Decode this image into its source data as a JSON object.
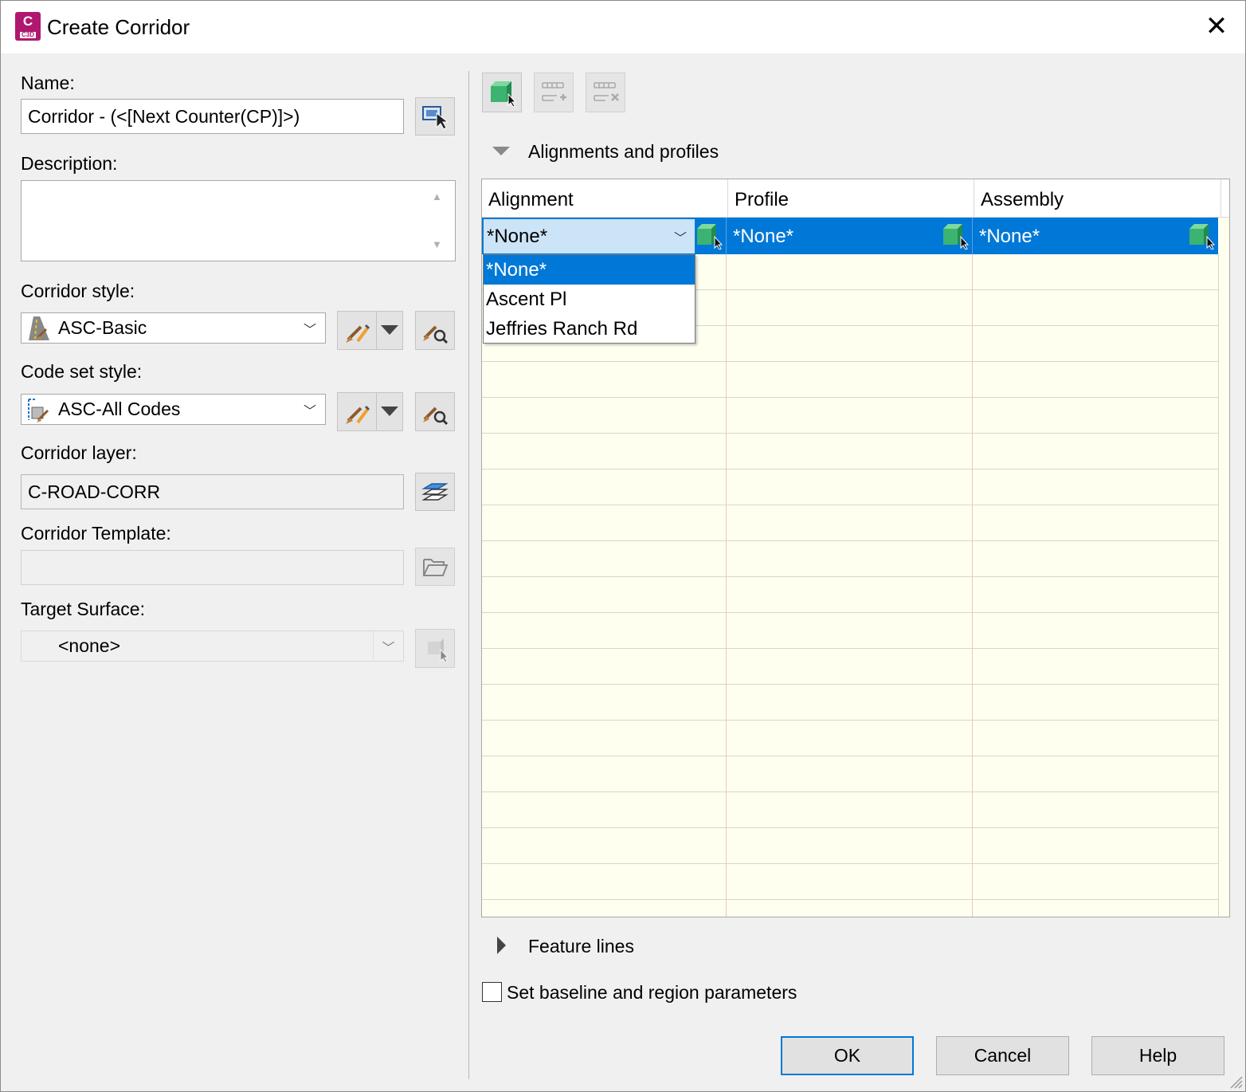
{
  "window": {
    "title": "Create Corridor",
    "app_icon": {
      "letter": "C",
      "sub": "C3D",
      "color": "#b0176e"
    },
    "close_glyph": "✕"
  },
  "form": {
    "name_label": "Name:",
    "name_value": "Corridor - (<[Next Counter(CP)]>)",
    "description_label": "Description:",
    "description_value": "",
    "corridor_style_label": "Corridor style:",
    "corridor_style_value": "ASC-Basic",
    "code_set_style_label": "Code set style:",
    "code_set_style_value": "ASC-All Codes",
    "corridor_layer_label": "Corridor layer:",
    "corridor_layer_value": "C-ROAD-CORR",
    "corridor_template_label": "Corridor Template:",
    "corridor_template_value": "",
    "target_surface_label": "Target Surface:",
    "target_surface_value": "<none>"
  },
  "alignments": {
    "section_title": "Alignments and profiles",
    "columns": [
      "Alignment",
      "Profile",
      "Assembly"
    ],
    "selected_row": {
      "alignment": "*None*",
      "profile": "*None*",
      "assembly": "*None*"
    },
    "dropdown_options": [
      "*None*",
      "Ascent Pl",
      "Jeffries Ranch Rd"
    ],
    "dropdown_selected": "*None*"
  },
  "feature_lines": {
    "section_title": "Feature lines"
  },
  "options": {
    "baseline_checkbox_label": "Set baseline and region parameters",
    "baseline_checked": false
  },
  "buttons": {
    "ok": "OK",
    "cancel": "Cancel",
    "help": "Help"
  },
  "colors": {
    "selection": "#0078d7",
    "grid_bg": "#fffff0",
    "cube": "#3cb371"
  }
}
